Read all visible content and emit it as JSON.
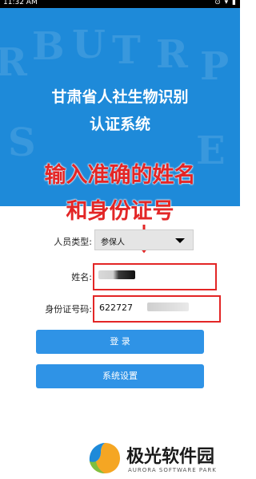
{
  "status_bar": {
    "time": "11:32 AM",
    "icons": "⊙ ▾ ▮"
  },
  "header": {
    "title_line1": "甘肃省人社生物识别",
    "title_line2": "认证系统"
  },
  "annotation": {
    "line1": "输入准确的姓名",
    "line2": "和身份证号"
  },
  "form": {
    "type_label": "人员类型:",
    "type_value": "参保人",
    "name_label": "姓名:",
    "name_value": "",
    "id_label": "身份证号码:",
    "id_value": "622727"
  },
  "buttons": {
    "login": "登 录",
    "settings": "系统设置"
  },
  "watermark": {
    "brand": "极光软件园",
    "sub": "AURORA SOFTWARE PARK"
  },
  "colors": {
    "hero": "#1e8ad9",
    "button": "#2f93e6",
    "annotation": "#e32626"
  }
}
